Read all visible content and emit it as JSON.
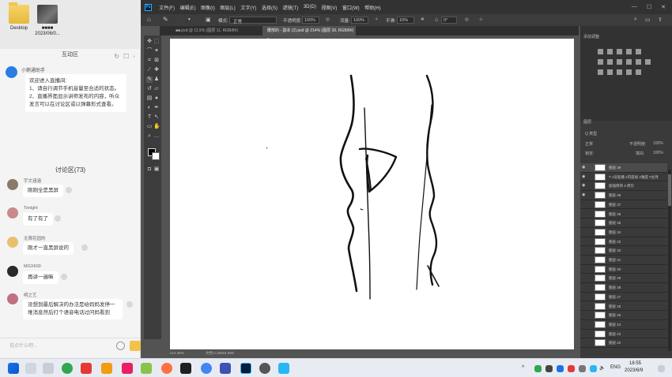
{
  "desktop": {
    "icons": [
      {
        "label": "Desktop",
        "icon": "folder-icon"
      },
      {
        "label": "■■■■\n2023/06/0...",
        "icon": "video-thumbnail"
      }
    ]
  },
  "chat": {
    "header_title": "互动区",
    "assistant": {
      "name": "小鹅通助手",
      "lines": [
        "欢迎进入直播间:",
        "1、请自行调节手机音量至合适的状态。",
        "2、直播界面显示讲师发布的内容，听众发言可以在讨论区或以弹幕形式查看。"
      ]
    },
    "discussion_title": "讨论区(73)",
    "messages": [
      {
        "name": "宇文涵涵",
        "text": "刚刚全是黑屏",
        "avatar_color": "#8a7a6a"
      },
      {
        "name": "Tonight",
        "text": "有了有了",
        "avatar_color": "#c98a8a"
      },
      {
        "name": "无限花园的",
        "text": "刚才一直黑屏说的",
        "avatar_color": "#e8c070"
      },
      {
        "name": "MGX600",
        "text": "再讲一遍嘛",
        "avatar_color": "#2a2a2a"
      },
      {
        "name": "明之艺",
        "text": "没想到最后解决的办法是给妈妈发停一堆消息然后打个语音电话过问妈看到",
        "avatar_color": "#c07080"
      }
    ],
    "input_placeholder": "说点什么吧..."
  },
  "photoshop": {
    "logo": "Ps",
    "menu": [
      "文件(F)",
      "编辑(E)",
      "图像(I)",
      "图层(L)",
      "文字(Y)",
      "选择(S)",
      "滤镜(T)",
      "3D(D)",
      "视图(V)",
      "窗口(W)",
      "帮助(H)"
    ],
    "options": {
      "mode_label": "模式:",
      "mode_value": "正常",
      "opacity_label": "不透明度:",
      "opacity_value": "100%",
      "flow_label": "流量:",
      "flow_value": "100%",
      "smooth_label": "平滑:",
      "smooth_value": "10%",
      "angle_value": "0°"
    },
    "tabs": [
      {
        "label": "■■.psd @ 11.9% (图层 11, RGB/8#)",
        "active": false
      },
      {
        "label": "腰部的 - 副本 (2).psd @ 214% (图层 39, RGB/8#) *",
        "active": true
      }
    ],
    "status": {
      "zoom": "214.48%",
      "doc": "文档:2.25M/4.69G"
    },
    "adjust_panel_title": "添加调整",
    "layers_panel": {
      "title": "图层",
      "kind_label": "Q 类型",
      "blend_mode": "正常",
      "opacity_label": "不透明度:",
      "opacity_value": "100%",
      "fill_label": "填充:",
      "fill_value": "100%",
      "lock_label": "锁定:",
      "layers": [
        {
          "name": "图层 39",
          "selected": true,
          "visible": true
        },
        {
          "name": "T 1号起播 2内容加 2难度 #主持",
          "selected": false,
          "visible": true
        },
        {
          "name": "加强修饰 4 拷贝",
          "selected": false,
          "visible": true
        },
        {
          "name": "图层 38",
          "selected": false,
          "visible": true
        },
        {
          "name": "图层 37",
          "selected": false,
          "visible": false
        },
        {
          "name": "图层 36",
          "selected": false,
          "visible": false
        },
        {
          "name": "图层 35",
          "selected": false,
          "visible": false
        },
        {
          "name": "图层 34",
          "selected": false,
          "visible": false
        },
        {
          "name": "图层 33",
          "selected": false,
          "visible": false
        },
        {
          "name": "图层 32",
          "selected": false,
          "visible": false
        },
        {
          "name": "图层 31",
          "selected": false,
          "visible": false
        },
        {
          "name": "图层 30",
          "selected": false,
          "visible": false
        },
        {
          "name": "图层 29",
          "selected": false,
          "visible": false
        },
        {
          "name": "图层 28",
          "selected": false,
          "visible": false
        },
        {
          "name": "图层 27",
          "selected": false,
          "visible": false
        },
        {
          "name": "图层 26",
          "selected": false,
          "visible": false
        },
        {
          "name": "图层 25",
          "selected": false,
          "visible": false
        },
        {
          "name": "图层 24",
          "selected": false,
          "visible": false
        },
        {
          "name": "图层 23",
          "selected": false,
          "visible": false
        },
        {
          "name": "图层 22",
          "selected": false,
          "visible": false
        }
      ]
    }
  },
  "taskbar": {
    "lang": "ENG",
    "time": "18:55",
    "date": "2023/6/9"
  }
}
